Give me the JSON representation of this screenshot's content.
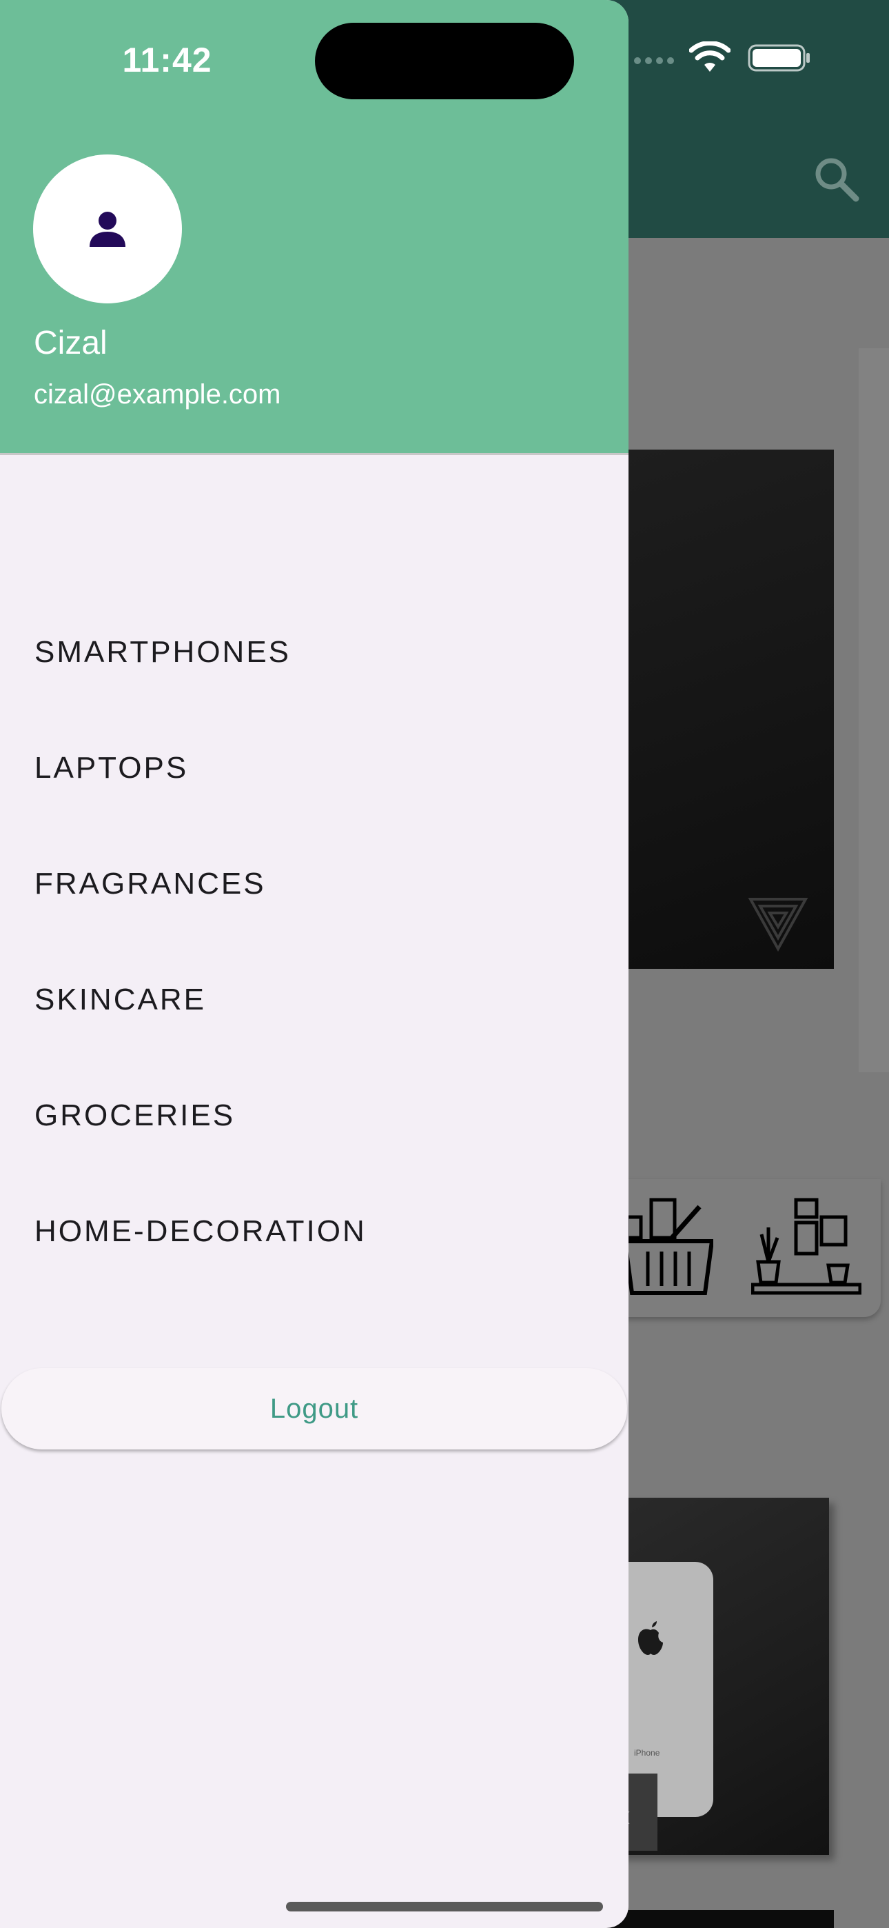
{
  "status_bar": {
    "time": "11:42"
  },
  "drawer": {
    "user": {
      "name": "Cizal",
      "email": "cizal@example.com"
    },
    "menu_items": [
      {
        "label": "SMARTPHONES"
      },
      {
        "label": "LAPTOPS"
      },
      {
        "label": "FRAGRANCES"
      },
      {
        "label": "SKINCARE"
      },
      {
        "label": "GROCERIES"
      },
      {
        "label": "HOME-DECORATION"
      }
    ],
    "logout_label": "Logout"
  },
  "background_app": {
    "phone_mockup_text": "iPhone",
    "carousel_prev_glyph": "‹"
  },
  "colors": {
    "drawer_header": "#6dbe98",
    "drawer_body": "#f4eff6",
    "app_bar": "#214b44",
    "logout_text": "#3f9a86",
    "avatar_icon": "#230a59"
  },
  "icons": [
    "search-icon",
    "wifi-icon",
    "battery-icon",
    "person-icon",
    "grocery-basket-icon",
    "home-decoration-icon",
    "apple-logo-icon"
  ]
}
